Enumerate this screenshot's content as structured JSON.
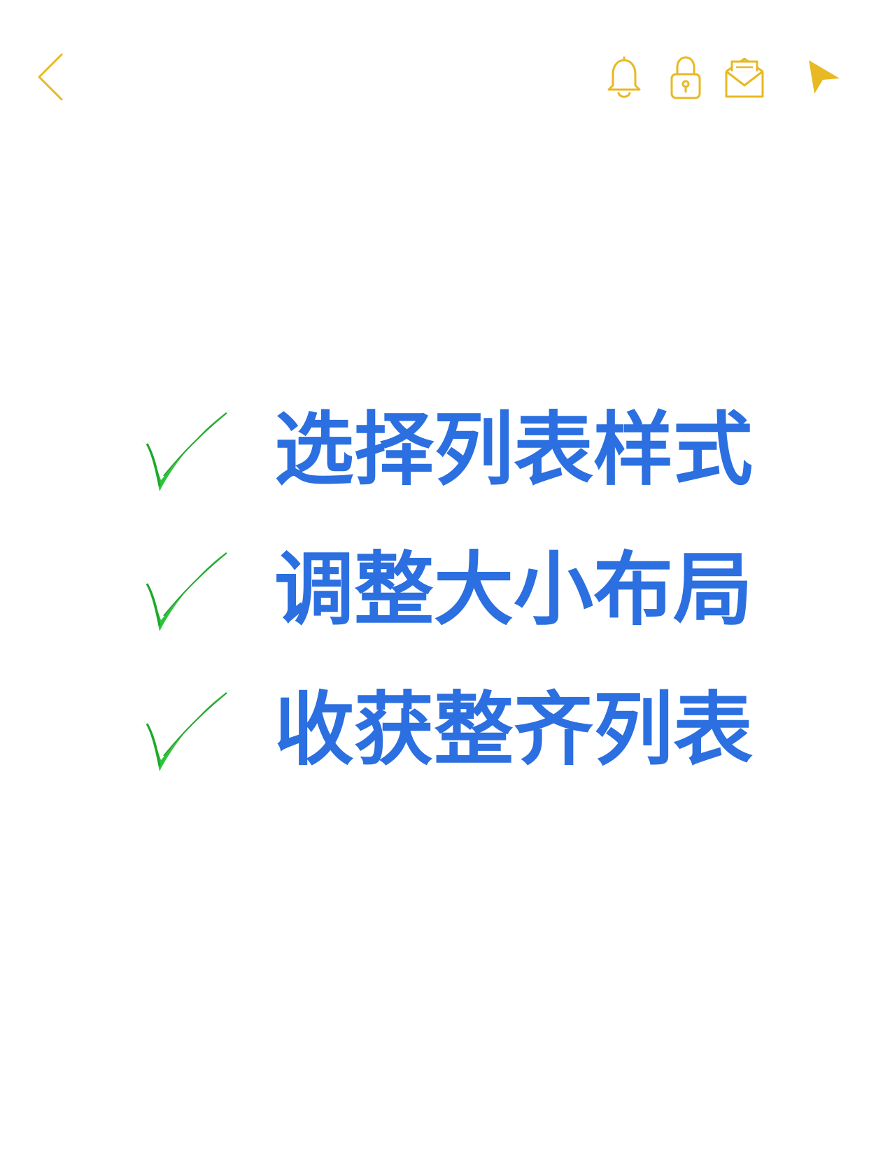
{
  "toolbar": {
    "icons": [
      "chevron-left-icon",
      "bell-icon",
      "lock-icon",
      "mail-icon",
      "share-arrow-icon"
    ],
    "icon_color": "#e8b923"
  },
  "checklist": {
    "text_color": "#2b6fe0",
    "check_color": "#2ec43a",
    "items": [
      {
        "label": "选择列表样式"
      },
      {
        "label": "调整大小布局"
      },
      {
        "label": "收获整齐列表"
      }
    ]
  }
}
